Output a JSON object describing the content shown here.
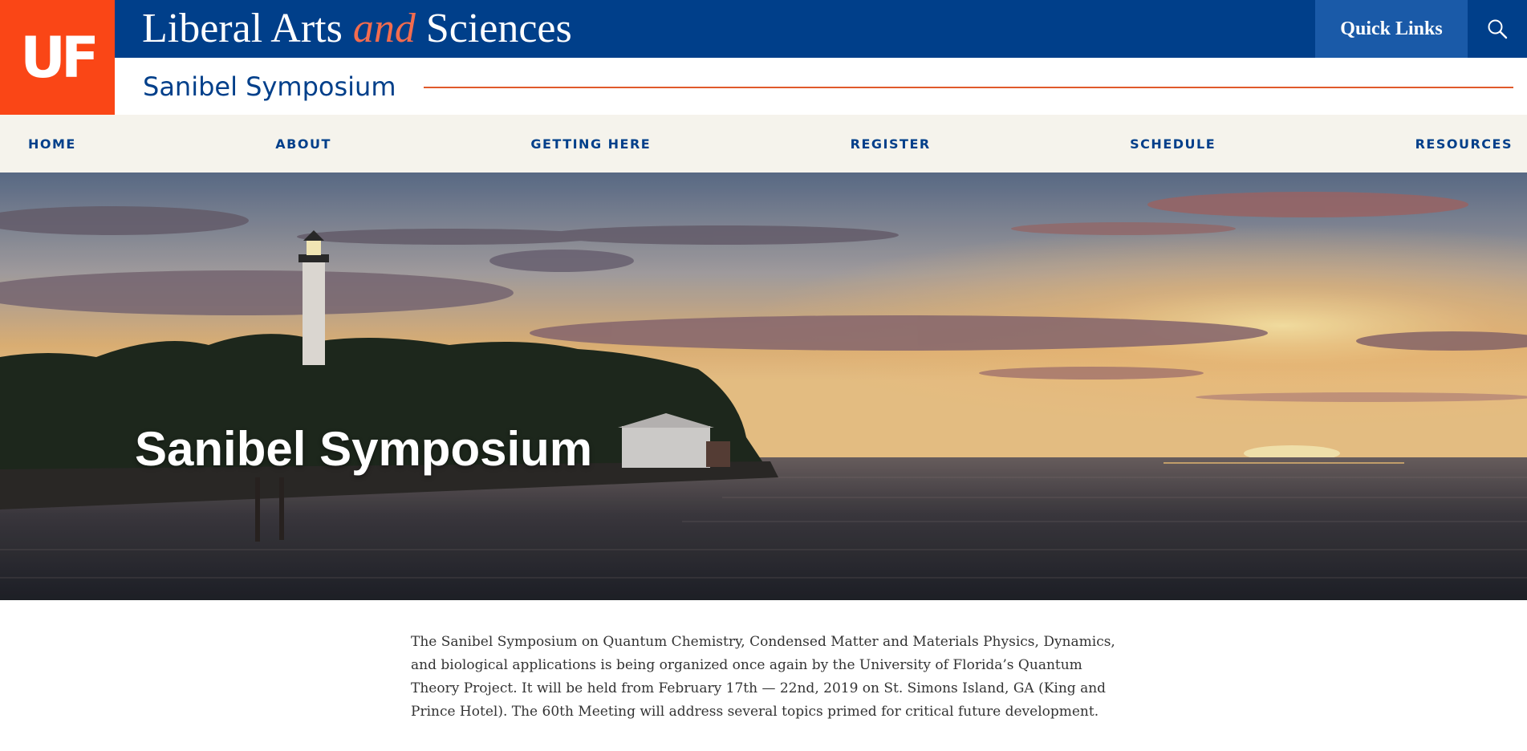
{
  "header": {
    "logo_text": "UF",
    "title_part1": "Liberal Arts ",
    "title_and": "and",
    "title_part2": " Sciences",
    "quick_links_label": "Quick Links",
    "search_icon": "search-icon",
    "subtitle": "Sanibel Symposium"
  },
  "nav": {
    "items": [
      {
        "label": "HOME"
      },
      {
        "label": "ABOUT"
      },
      {
        "label": "GETTING HERE"
      },
      {
        "label": "REGISTER"
      },
      {
        "label": "SCHEDULE"
      },
      {
        "label": "RESOURCES"
      }
    ]
  },
  "hero": {
    "title": "Sanibel Symposium"
  },
  "main": {
    "intro": "The Sanibel Symposium on Quantum Chemistry, Condensed Matter and Materials Physics, Dynamics, and biological applications is being organized once again by the University of Florida’s Quantum Theory Project. It will be held from February 17th — 22nd, 2019 on St. Simons Island, GA (King and Prince Hotel). The 60th Meeting will address several topics primed for critical future development."
  },
  "colors": {
    "uf_orange": "#fa4616",
    "uf_blue": "#003f8a",
    "quick_links_bg": "#1a5aa8",
    "nav_bg": "#f5f3ec"
  }
}
